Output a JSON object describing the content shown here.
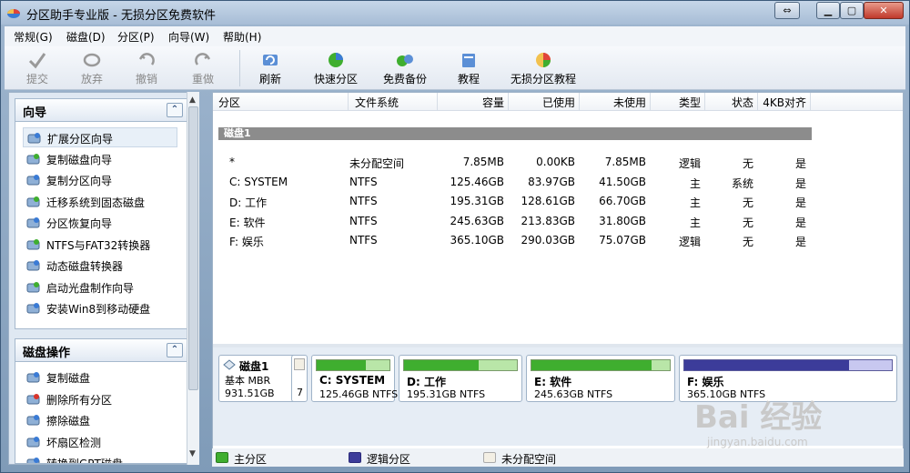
{
  "window": {
    "title": "分区助手专业版 - 无损分区免费软件"
  },
  "menu": [
    "常规(G)",
    "磁盘(D)",
    "分区(P)",
    "向导(W)",
    "帮助(H)"
  ],
  "toolbar": {
    "commit": "提交",
    "discard": "放弃",
    "undo": "撤销",
    "redo": "重做",
    "refresh": "刷新",
    "quick_partition": "快速分区",
    "free_backup": "免费备份",
    "tutorial": "教程",
    "lossless_tutorial": "无损分区教程"
  },
  "wizard": {
    "title": "向导",
    "items": [
      "扩展分区向导",
      "复制磁盘向导",
      "复制分区向导",
      "迁移系统到固态磁盘",
      "分区恢复向导",
      "NTFS与FAT32转换器",
      "动态磁盘转换器",
      "启动光盘制作向导",
      "安装Win8到移动硬盘"
    ]
  },
  "disk_ops": {
    "title": "磁盘操作",
    "items": [
      "复制磁盘",
      "删除所有分区",
      "擦除磁盘",
      "坏扇区检测",
      "转换到GPT磁盘"
    ]
  },
  "table": {
    "headers": [
      "分区",
      "文件系统",
      "容量",
      "已使用",
      "未使用",
      "类型",
      "状态",
      "4KB对齐"
    ],
    "disk_label": "磁盘1",
    "rows": [
      [
        "*",
        "未分配空间",
        "7.85MB",
        "0.00KB",
        "7.85MB",
        "逻辑",
        "无",
        "是"
      ],
      [
        "C: SYSTEM",
        "NTFS",
        "125.46GB",
        "83.97GB",
        "41.50GB",
        "主",
        "系统",
        "是"
      ],
      [
        "D: 工作",
        "NTFS",
        "195.31GB",
        "128.61GB",
        "66.70GB",
        "主",
        "无",
        "是"
      ],
      [
        "E: 软件",
        "NTFS",
        "245.63GB",
        "213.83GB",
        "31.80GB",
        "主",
        "无",
        "是"
      ],
      [
        "F: 娱乐",
        "NTFS",
        "365.10GB",
        "290.03GB",
        "75.07GB",
        "逻辑",
        "无",
        "是"
      ]
    ]
  },
  "diskmap": {
    "disk_name": "磁盘1",
    "disk_type": "基本 MBR",
    "disk_size": "931.51GB",
    "unalloc_label": "7",
    "partitions": [
      {
        "name": "C: SYSTEM",
        "info": "125.46GB NTFS",
        "used": 0.669
      },
      {
        "name": "D: 工作",
        "info": "195.31GB NTFS",
        "used": 0.658
      },
      {
        "name": "E: 软件",
        "info": "245.63GB NTFS",
        "used": 0.87
      },
      {
        "name": "F: 娱乐",
        "info": "365.10GB NTFS",
        "used": 0.794
      }
    ]
  },
  "legend": {
    "primary": "主分区",
    "logical": "逻辑分区",
    "unallocated": "未分配空间"
  },
  "colors": {
    "primary": "#3fae2f",
    "logical": "#3c3c9a",
    "accent": "#2a4a7a"
  },
  "watermark": {
    "text": "Bai 经验",
    "url": "jingyan.baidu.com"
  }
}
